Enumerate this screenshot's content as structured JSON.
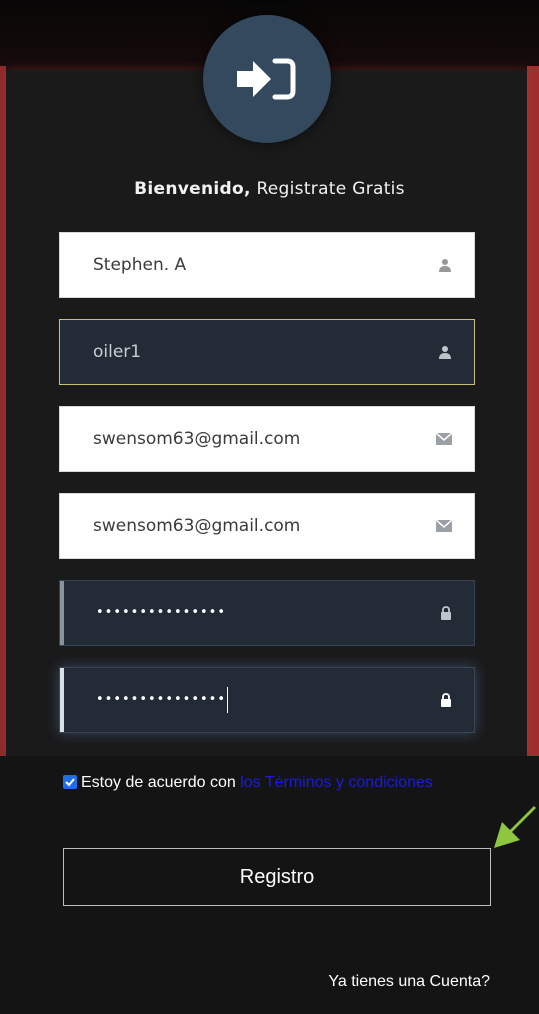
{
  "header": {
    "welcome_bold": "Bienvenido,",
    "welcome_rest": " Registrate Gratis"
  },
  "form": {
    "fullname": {
      "value": "Stephen. A",
      "icon": "user-icon"
    },
    "username": {
      "value": "oiler1",
      "icon": "user-icon"
    },
    "email": {
      "value": "swensom63@gmail.com",
      "icon": "envelope-icon"
    },
    "email_confirm": {
      "value": "swensom63@gmail.com",
      "icon": "envelope-icon"
    },
    "password": {
      "value": "•••••••••••••••",
      "icon": "lock-icon"
    },
    "password_confirm": {
      "value": "•••••••••••••••",
      "icon": "lock-icon"
    }
  },
  "terms": {
    "checked": true,
    "text": "Estoy de acuerdo con ",
    "link": "los Términos y condiciones"
  },
  "submit_label": "Registro",
  "login_link": "Ya tienes una Cuenta?",
  "colors": {
    "avatar": "#34495e",
    "link": "#1a1ae0",
    "checkbox": "#1e6fe6",
    "arrow": "#8dc63f",
    "card_edge": "#9e2f2f"
  }
}
